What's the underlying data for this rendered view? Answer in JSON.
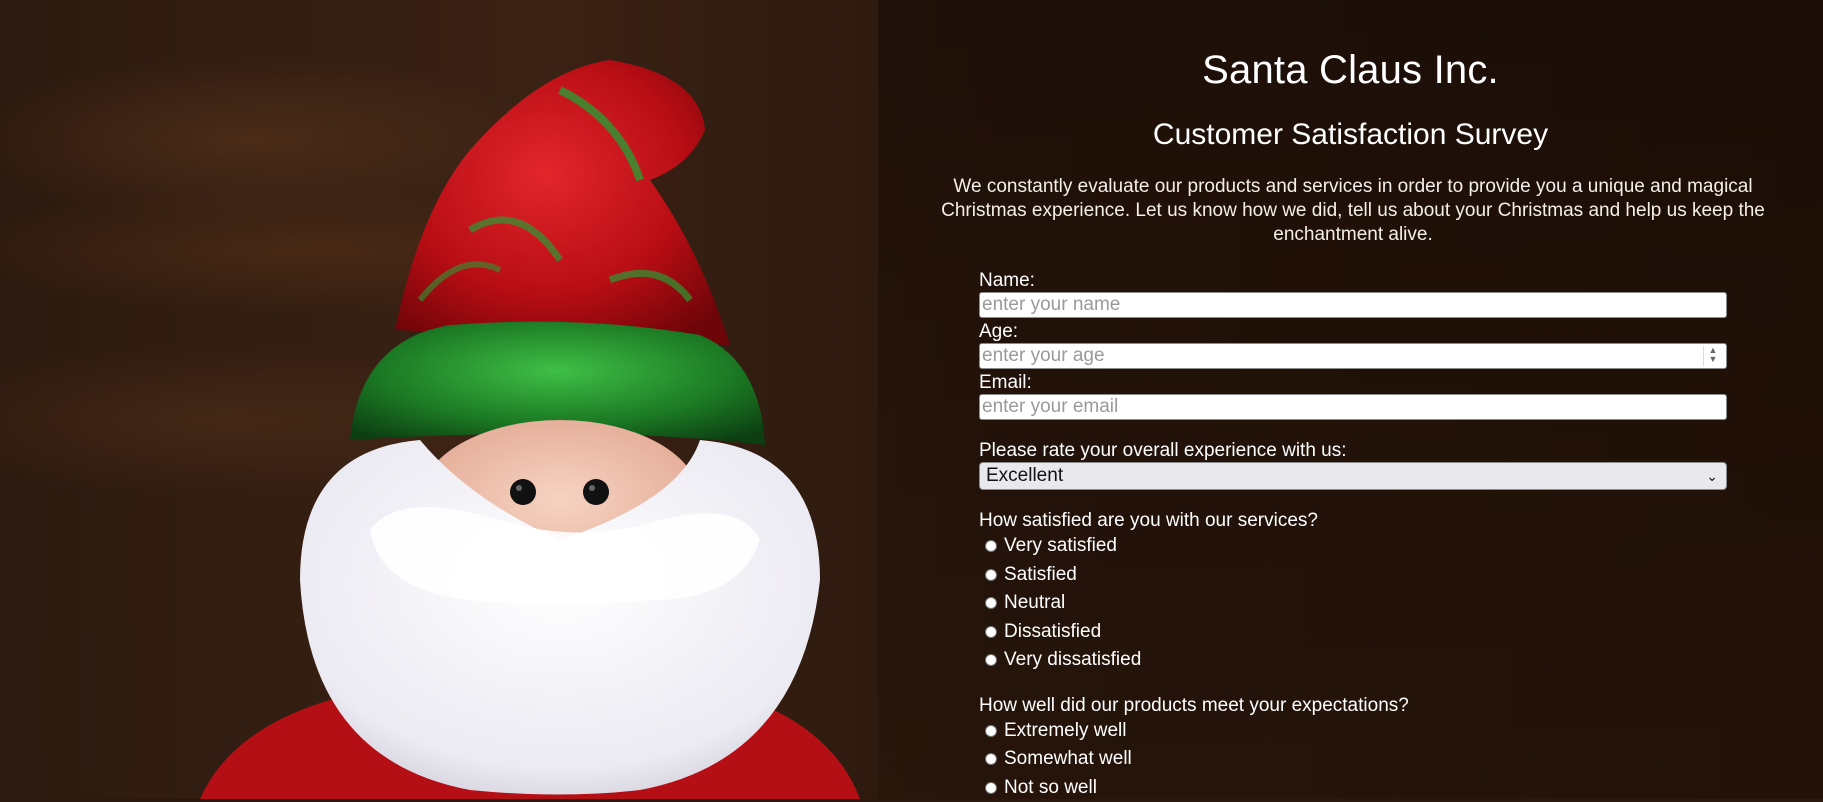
{
  "header": {
    "title": "Santa Claus Inc.",
    "subtitle": "Customer Satisfaction Survey",
    "intro": "We constantly evaluate our products and services in order to provide you a unique and magical Christmas experience. Let us know how we did, tell us about your Christmas and help us keep the enchantment alive."
  },
  "form": {
    "name": {
      "label": "Name:",
      "placeholder": "enter your name"
    },
    "age": {
      "label": "Age:",
      "placeholder": "enter your age"
    },
    "email": {
      "label": "Email:",
      "placeholder": "enter your email"
    },
    "rating": {
      "label": "Please rate your overall experience with us:",
      "selected": "Excellent"
    },
    "services": {
      "question": "How satisfied are you with our services?",
      "options": [
        "Very satisfied",
        "Satisfied",
        "Neutral",
        "Dissatisfied",
        "Very dissatisfied"
      ]
    },
    "products": {
      "question": "How well did our products meet your expectations?",
      "options": [
        "Extremely well",
        "Somewhat well",
        "Not so well"
      ]
    }
  },
  "colors": {
    "background": "#2a170d",
    "hat_red": "#c41118",
    "hat_trim_green": "#1f8a2a",
    "beard_white": "#f4f4f4"
  }
}
